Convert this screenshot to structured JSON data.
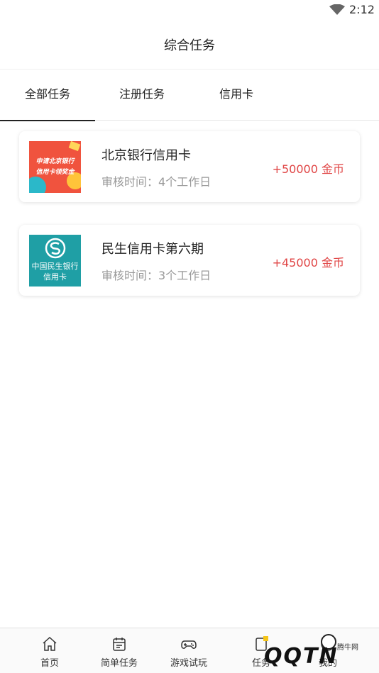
{
  "status_bar": {
    "time": "2:12"
  },
  "header": {
    "title": "综合任务"
  },
  "tabs": [
    {
      "label": "全部任务",
      "active": true
    },
    {
      "label": "注册任务",
      "active": false
    },
    {
      "label": "信用卡",
      "active": false
    }
  ],
  "tasks": [
    {
      "title": "北京银行信用卡",
      "review": "审核时间：4个工作日",
      "reward": "+50000 金币",
      "thumb_text_1": "申请北京银行",
      "thumb_text_2": "信用卡领奖金"
    },
    {
      "title": "民生信用卡第六期",
      "review": "审核时间：3个工作日",
      "reward": "+45000 金币",
      "thumb_text_1": "中国民生银行",
      "thumb_text_2": "信用卡"
    }
  ],
  "bottom_nav": [
    {
      "label": "首页",
      "icon": "home-icon"
    },
    {
      "label": "简单任务",
      "icon": "calendar-icon"
    },
    {
      "label": "游戏试玩",
      "icon": "gamepad-icon"
    },
    {
      "label": "任务",
      "icon": "task-icon"
    },
    {
      "label": "我的",
      "icon": "smile-icon"
    }
  ],
  "watermark": {
    "text": "QQTN",
    "small": "腾牛网"
  },
  "colors": {
    "reward": "#e04545",
    "active_tab_underline": "#222222"
  }
}
